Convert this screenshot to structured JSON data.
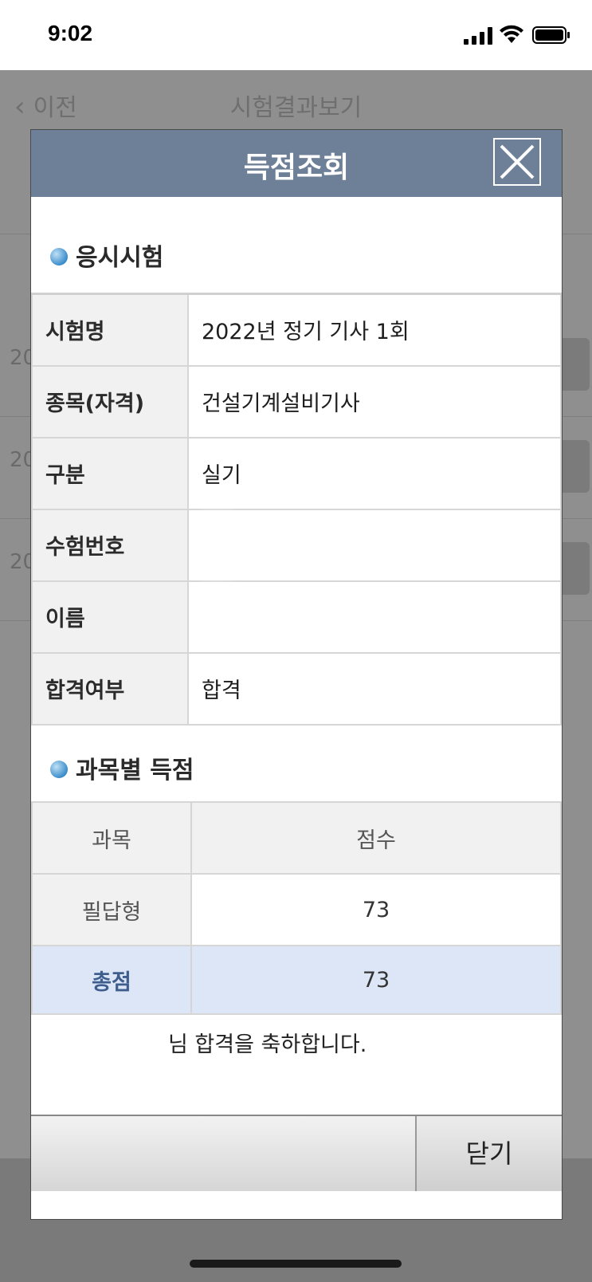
{
  "status_bar": {
    "time": "9:02"
  },
  "background": {
    "back_label": "이전",
    "title": "시험결과보기",
    "row_prefix": [
      "20",
      "20",
      "20"
    ]
  },
  "modal": {
    "title": "득점조회",
    "exam_section_title": "응시시험",
    "fields": [
      {
        "label": "시험명",
        "value": "2022년 정기 기사 1회"
      },
      {
        "label": "종목(자격)",
        "value": "건설기계설비기사"
      },
      {
        "label": "구분",
        "value": "실기"
      },
      {
        "label": "수험번호",
        "value": ""
      },
      {
        "label": "이름",
        "value": ""
      },
      {
        "label": "합격여부",
        "value": "합격"
      }
    ],
    "score_section_title": "과목별 득점",
    "score_header": {
      "subject": "과목",
      "score": "점수"
    },
    "scores": [
      {
        "subject": "필답형",
        "score": "73"
      }
    ],
    "total": {
      "label": "총점",
      "score": "73"
    },
    "congrats_text": "님 합격을 축하합니다.",
    "close_button": "닫기"
  }
}
